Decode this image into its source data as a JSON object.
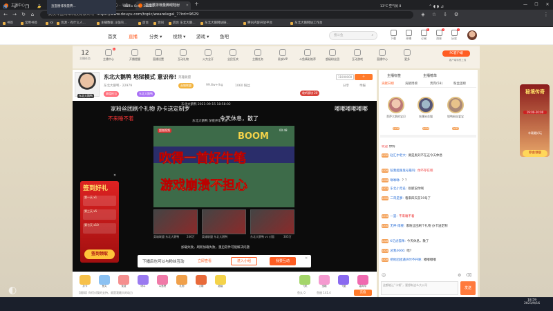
{
  "browser": {
    "tabs": [
      {
        "label": "主播中心"
      },
      {
        "label": "我的资料 - 个人中心 - 斗鱼"
      },
      {
        "label": "直面腰排噢量腾眼鞋射"
      },
      {
        "label": "主播中心"
      }
    ],
    "url": "https://www.douyu.com/topic/wearelegal_7?ird=9629",
    "url_prefix": "武汉斗鱼网络科技有限公司",
    "bookmarks": [
      "书签",
      "常用书签",
      "lol",
      "资源 - 有什么人...",
      "主播数据 斗鱼的...",
      "后台",
      "合同",
      "后台 东北大鹅...",
      "东北大鹅网站链...",
      "腾讯内容开放平台",
      "东北大鹅网站工作台"
    ]
  },
  "header": {
    "nav": [
      "首页",
      "直播",
      "分类",
      "视频",
      "游戏",
      "鱼吧"
    ],
    "active_nav": "直播",
    "search_placeholder": "搜斗鱼",
    "icons": [
      {
        "label": "下载"
      },
      {
        "label": "开播"
      },
      {
        "label": "订阅"
      },
      {
        "label": "消息"
      },
      {
        "label": "历史"
      },
      {
        "label": "鱼吧"
      }
    ],
    "badges": [
      "1",
      "2",
      "1"
    ]
  },
  "featurebar": {
    "level_number": "12",
    "level_label": "主播任务",
    "items": [
      "主播中心",
      "开播提醒",
      "直播设置",
      "互动礼物",
      "火力全开",
      "全民狂欢",
      "主播任务",
      "贵族VIP",
      "斗鱼精彩推荐",
      "超级粉丝团",
      "互动游戏",
      "直播中心",
      "更多"
    ],
    "badge": "1",
    "pc_client": "PC客户端",
    "pc_client_sub": "客户端特别上线"
  },
  "anchor": {
    "room_title": "东北大鹅鸭 地狱模式 意识帝!",
    "name": "东北大鹅鸭",
    "room_id": "22979",
    "category": "英雄联盟",
    "hot": "99.8w+/kg",
    "fans": "1060 粉丝",
    "subscribe_count": "11000000",
    "tags": [
      "颜值担当",
      "英雄联盟",
      "东北大鹅鸭"
    ],
    "share": "分享",
    "report": "举报",
    "badge_label": "收听版块 20"
  },
  "video": {
    "watermark_top": "东北大鹅鸭 2021-09-15 18:58:02",
    "marquee_left": "家粉丝团刷个礼物 办卡送定制罗",
    "marquee_right": "嘟嘟嘟嘟嘟嘟",
    "night_text": "不来睡不着",
    "rest_text": "今天休息，散了",
    "inner_caption": "东北大鹅鸭 深夜开车专场",
    "boom": "BOOM",
    "headline1": "吹得一首好牛笔",
    "headline2": "游戏崩溃不担心",
    "duration": "00:48",
    "badge": "超燃视频",
    "plays": [
      "246万",
      "305万"
    ],
    "thumb_captions": [
      "英雄联盟 东北大鹅鸭",
      "英雄联盟 东北大鹅鸭",
      "东北大鹅鸭 vs 对面"
    ],
    "status_line": "加载失败，刷新加载失败，重启软件可能解决问题",
    "gift_panel_title": "签到好礼",
    "gift_days": [
      "第一天",
      "第三天",
      "第七天"
    ],
    "gift_values": [
      "x1",
      "x5",
      "x10"
    ],
    "gift_button": "签到领取"
  },
  "follow_bar": {
    "text": "下播后也可以与粉丝互动",
    "link": "立即查看",
    "btn1": "进入小组",
    "btn2": "我要互动"
  },
  "giftbar": {
    "items": [
      "办卡",
      "鱼丸",
      "免费",
      "呀斗",
      "斗鱼榜",
      "礼物",
      "火箭",
      "超级",
      "飞机",
      "宝箱",
      "飞艇",
      "嘉年华",
      "火箭"
    ],
    "bottom_left": "【通知】你们对我的支持，就是我最大的动力",
    "balance": "鱼丸 0",
    "coins": "鱼翅 141.4",
    "recharge": "充值"
  },
  "chat": {
    "tabs": [
      "主播标签",
      "主播榜单"
    ],
    "subtabs": [
      "贡献日榜",
      "贡献周榜",
      "贵宾(58)",
      "粉丝团榜"
    ],
    "fans": [
      {
        "name": "菩萨大鹅的宝贝"
      },
      {
        "name": "吃爆米花猫"
      },
      {
        "name": "锁鸭粉丝爱宝"
      }
    ],
    "fan_levels": [
      "LV30",
      "LV36",
      "LV32"
    ],
    "messages": [
      {
        "level": "LV",
        "name": "欢迎",
        "text": "你好"
      },
      {
        "level": "LV30",
        "name": "赵汇尔老大:",
        "text": "要是奥刘不在这今天休息"
      },
      {
        "level": "LV26",
        "name": "陪我能跟鬼号最吗:",
        "text": "你不存在吧"
      },
      {
        "level": "LV26",
        "name": "咻咻咻:",
        "text": "？？"
      },
      {
        "level": "LV21",
        "name": "东北小无名:",
        "text": "别腻说你啊"
      },
      {
        "level": "LV20",
        "name": "二哥是爹:",
        "text": "看来四天前19号了"
      },
      {
        "level": "LV15",
        "name": "一罢:",
        "text": "不来睡不着"
      },
      {
        "level": "LV30",
        "name": "无神-雨楼:",
        "text": "家粉丝团刷个礼物 办卡送定制"
      },
      {
        "level": "LV26",
        "name": "K亿虎猫咪:",
        "text": "今天休息，散了"
      },
      {
        "level": "LV24",
        "name": "总我4666:",
        "text": "哈？"
      },
      {
        "level": "LV28",
        "name": "把他团团遇声时不开呢:",
        "text": "嘟嘟嘟嘟"
      }
    ],
    "input_placeholder": "这都能让“卡顿”，要想有这么大公司",
    "send": "发送"
  },
  "ad": {
    "title": "秘境传奇",
    "sub": "19:00-20:00",
    "label": "车载最好玩",
    "cta": "参会领取"
  },
  "taskbar": {
    "apps": [
      "直面腰排噢量腾...",
      "Studio One - 2021..."
    ],
    "weather": "13°C 空气优 8",
    "time": "18:59",
    "date": "2021/9/16"
  }
}
